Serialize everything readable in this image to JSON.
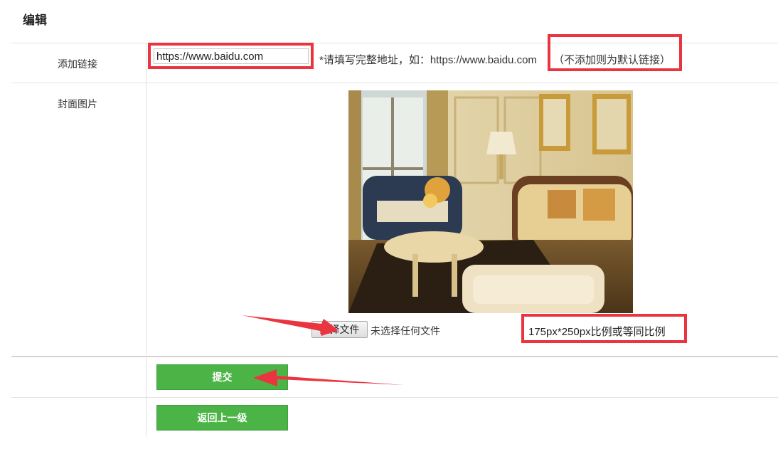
{
  "header": {
    "title": "编辑"
  },
  "form": {
    "link": {
      "label": "添加链接",
      "value": "https://www.baidu.com",
      "hint_prefix": "*请填写完整地址，如：https://www.baidu.com",
      "hint_suffix": "（不添加则为默认链接）"
    },
    "cover": {
      "label": "封面图片",
      "choose_file_label": "选择文件",
      "no_file_text": "未选择任何文件",
      "size_hint": "175px*250px比例或等同比例"
    },
    "submit_label": "提交",
    "back_label": "返回上一级"
  },
  "colors": {
    "accent_green": "#4cb447",
    "annotation_red": "#ea3540"
  }
}
